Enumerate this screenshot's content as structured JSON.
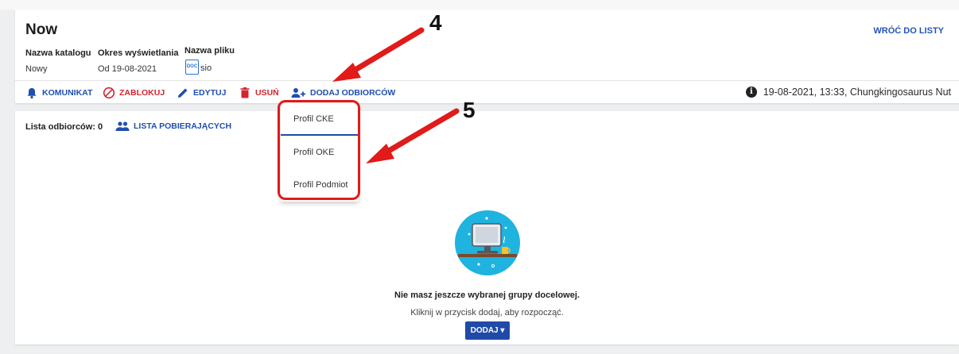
{
  "header": {
    "title": "Now",
    "back_link": "WRÓĆ DO LISTY",
    "catalog_label": "Nazwa katalogu",
    "catalog_value": "Nowy",
    "period_label": "Okres wyświetlania",
    "period_value": "Od 19-08-2021",
    "file_label": "Nazwa pliku",
    "file_icon_text": "DOC",
    "file_value": "sio"
  },
  "toolbar": {
    "message": "KOMUNIKAT",
    "block": "ZABLOKUJ",
    "edit": "EDYTUJ",
    "delete": "USUŃ",
    "add_recipients": "DODAJ ODBIORCÓW",
    "info_text": "19-08-2021, 13:33, Chungkingosaurus Nut"
  },
  "recipients": {
    "label": "Lista odbiorców: 0",
    "downloaders_link": "LISTA POBIERAJĄCYCH"
  },
  "dropdown": {
    "items": [
      "Profil CKE",
      "Profil OKE",
      "Profil Podmiot"
    ]
  },
  "empty_state": {
    "title": "Nie masz jeszcze wybranej grupy docelowej.",
    "subtitle": "Kliknij w przycisk dodaj, aby rozpocząć.",
    "button": "DODAJ ▾"
  },
  "annotations": {
    "step_4": "4",
    "step_5": "5"
  },
  "colors": {
    "primary": "#2049a8",
    "danger": "#d4252d",
    "annotation": "#e11a1a",
    "illustration_bg": "#1fb3e0"
  },
  "icons": {
    "message": "bell-icon",
    "block": "block-icon",
    "edit": "pencil-icon",
    "delete": "trash-icon",
    "add_recipients": "add-users-icon",
    "info": "info-icon",
    "downloaders": "users-icon",
    "file": "doc-file-icon"
  }
}
